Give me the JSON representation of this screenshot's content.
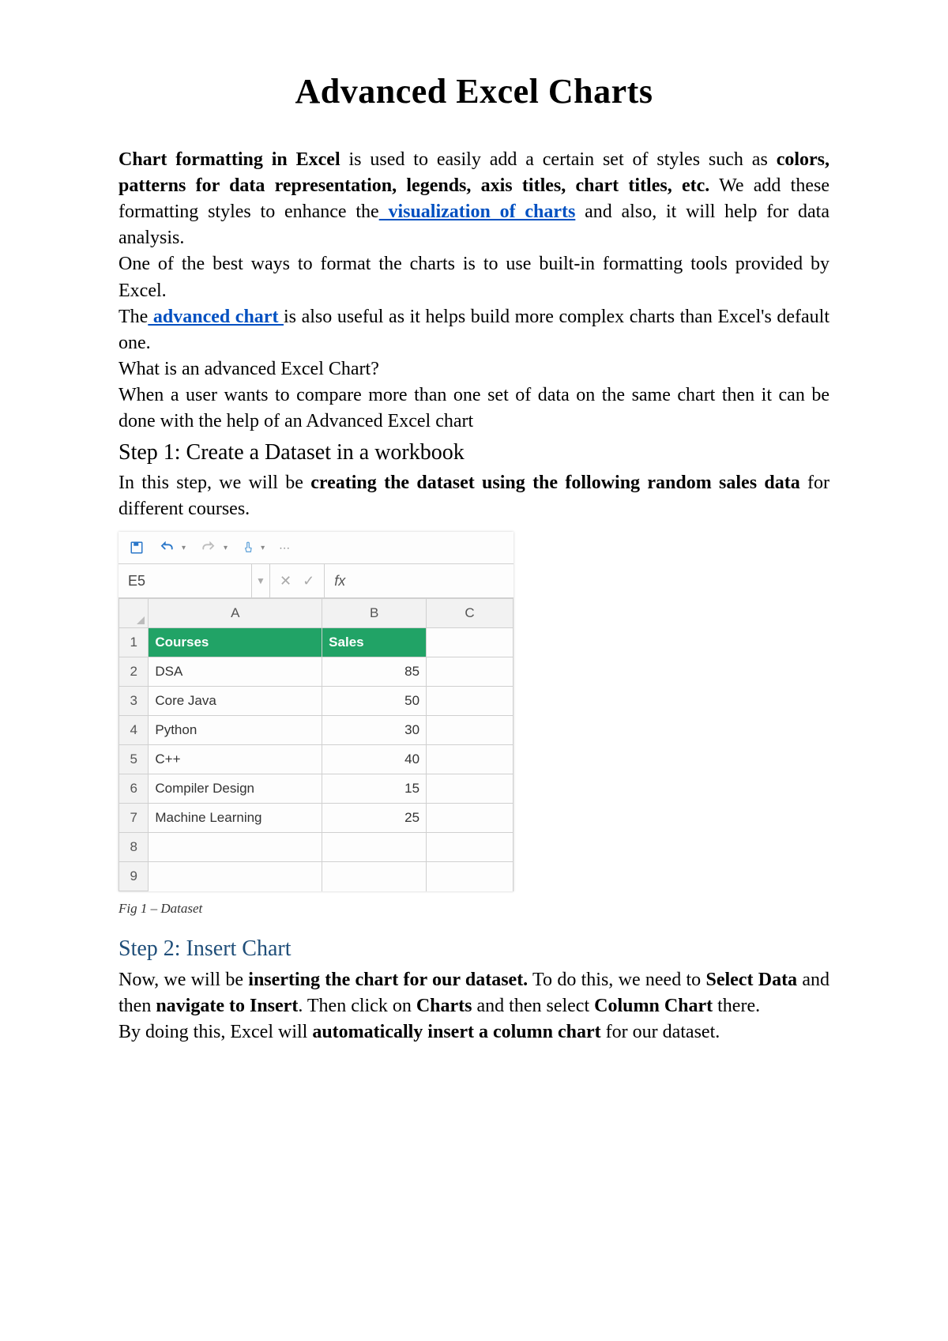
{
  "title": "Advanced Excel Charts",
  "p1": {
    "t1": "Chart formatting in Excel",
    "t2": " is used to easily add a certain set of styles such as ",
    "t3": "colors, patterns for data representation, legends, axis titles, chart titles, etc.",
    "t4": " We add these formatting styles to enhance the",
    "link1": " visualization of charts",
    "t5": " and also, it will help for data analysis."
  },
  "p2": "One of the best ways to format the charts is to use built-in formatting tools provided by Excel.",
  "p3": {
    "t1": "The",
    "link2": " advanced chart ",
    "t2": "is also useful as it helps build more complex charts than Excel's default one."
  },
  "p4": "What is an advanced Excel Chart?",
  "p5": "When a user wants to compare more than one set of data on the same chart then it can be done with the help of an Advanced Excel chart",
  "step1": "Step 1: Create a Dataset in a workbook",
  "p6": {
    "t1": "In this step, we will be ",
    "t2": "creating the dataset using the following random sales data",
    "t3": " for different courses."
  },
  "excel": {
    "namebox": "E5",
    "fx": "fx",
    "colA": "A",
    "colB": "B",
    "colC": "C",
    "headerCourses": "Courses",
    "headerSales": "Sales",
    "rownums": [
      "1",
      "2",
      "3",
      "4",
      "5",
      "6",
      "7",
      "8",
      "9"
    ]
  },
  "chart_data": {
    "type": "table",
    "title": "Dataset",
    "columns": [
      "Courses",
      "Sales"
    ],
    "rows": [
      {
        "Courses": "DSA",
        "Sales": 85
      },
      {
        "Courses": "Core Java",
        "Sales": 50
      },
      {
        "Courses": "Python",
        "Sales": 30
      },
      {
        "Courses": "C++",
        "Sales": 40
      },
      {
        "Courses": "Compiler Design",
        "Sales": 15
      },
      {
        "Courses": "Machine Learning",
        "Sales": 25
      }
    ]
  },
  "caption1": "Fig 1 – Dataset",
  "step2": "Step 2: Insert Chart",
  "p7": {
    "t1": "Now, we will be ",
    "t2": "inserting the chart for our dataset.",
    "t3": " To do this, we need to ",
    "t4": "Select Data",
    "t5": " and then ",
    "t6": "navigate to Insert",
    "t7": ". Then click on ",
    "t8": "Charts",
    "t9": " and then select ",
    "t10": "Column Chart",
    "t11": " there."
  },
  "p8": {
    "t1": "By doing this, Excel will ",
    "t2": "automatically insert a column chart",
    "t3": " for our dataset."
  }
}
